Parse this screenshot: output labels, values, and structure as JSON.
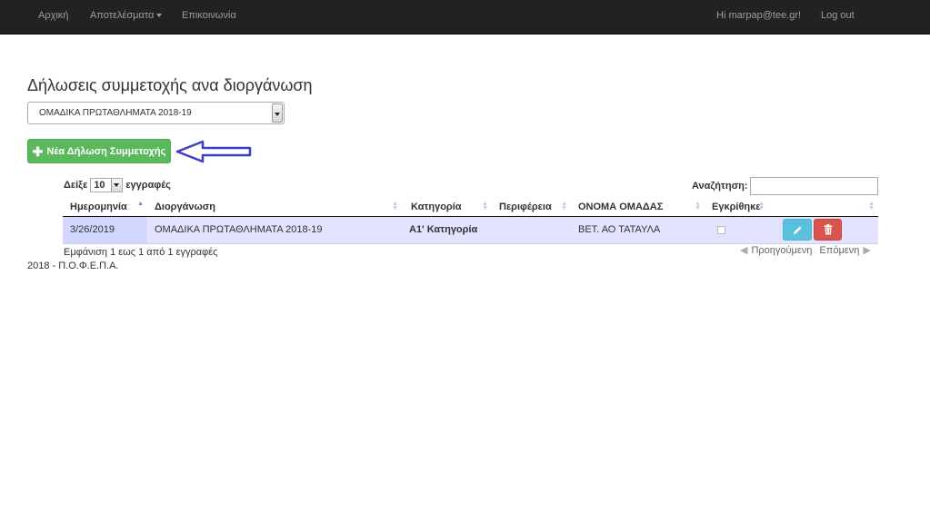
{
  "nav": {
    "home": "Αρχική",
    "results": "Αποτελέσματα",
    "contact": "Επικοινωνία",
    "greeting": "Hi marpap@tee.gr!",
    "logout": "Log out"
  },
  "page": {
    "title": "Δήλωσεις συμμετοχής ανα διοργάνωση",
    "competition_select": "ΟΜΑΔΙΚΑ ΠΡΩΤΑΘΛΗΜΑΤΑ 2018-19",
    "new_button": "Νέα Δήλωση Συμμετοχής"
  },
  "table_controls": {
    "show_label": "Δείξε",
    "page_length": "10",
    "records_label": "εγγραφές",
    "search_label": "Αναζήτηση:",
    "search_value": ""
  },
  "table": {
    "headers": [
      "Ημερομηνία",
      "Διοργάνωση",
      "Κατηγορία",
      "Περιφέρεια",
      "ΟΝΟΜΑ ΟΜΑΔΑΣ",
      "Εγκρίθηκε",
      ""
    ],
    "rows": [
      {
        "date": "3/26/2019",
        "competition": "ΟΜΑΔΙΚΑ ΠΡΩΤΑΘΛΗΜΑΤΑ 2018-19",
        "category": "Α1' Κατηγορία",
        "region": "",
        "team": "ΒΕΤ. ΑΟ ΤΑΤΑΥΛΑ",
        "approved": false
      }
    ],
    "info": "Εμφάνιση 1 εως 1 από 1 εγγραφές",
    "prev": "Προηγούμενη",
    "next": "Επόμενη"
  },
  "footer": "2018 - Π.Ο.Φ.Ε.Π.Α.",
  "colors": {
    "navbar": "#222222",
    "success": "#5cb85c",
    "info": "#5bc0de",
    "danger": "#d9534f",
    "annotation_arrow": "#3b3fc4",
    "row_highlight": "#e2e4ff"
  },
  "icons": [
    "plus-icon",
    "pencil-icon",
    "trash-icon",
    "sort-asc-icon",
    "sort-both-icon",
    "prev-arrow-icon",
    "next-arrow-icon"
  ]
}
